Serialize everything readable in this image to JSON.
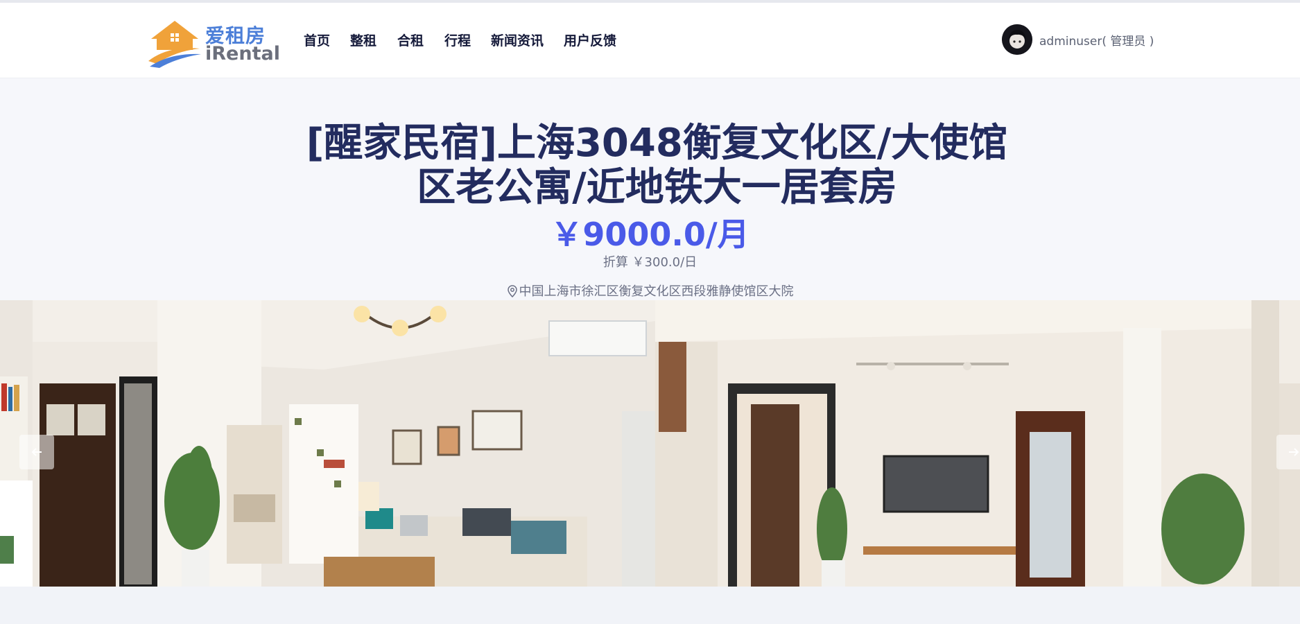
{
  "brand": {
    "name_cn": "爱租房",
    "name_en": "iRental"
  },
  "nav": {
    "items": [
      {
        "label": "首页"
      },
      {
        "label": "整租"
      },
      {
        "label": "合租"
      },
      {
        "label": "行程"
      },
      {
        "label": "新闻资讯"
      },
      {
        "label": "用户反馈"
      }
    ]
  },
  "user": {
    "name": "adminuser( 管理员 )"
  },
  "listing": {
    "title": "[醒家民宿]上海3048衡复文化区/大使馆区老公寓/近地铁大一居套房",
    "price": "￥9000.0/月",
    "daily": "折算 ￥300.0/日",
    "address": "中国上海市徐汇区衡复文化区西段雅静使馆区大院"
  },
  "gallery": {
    "prev_icon": "arrow-left-icon",
    "next_icon": "arrow-right-icon"
  },
  "colors": {
    "title": "#232c5f",
    "price": "#4a5ae8",
    "logo_blue": "#4c7fd8",
    "logo_orange": "#f0a23a"
  }
}
